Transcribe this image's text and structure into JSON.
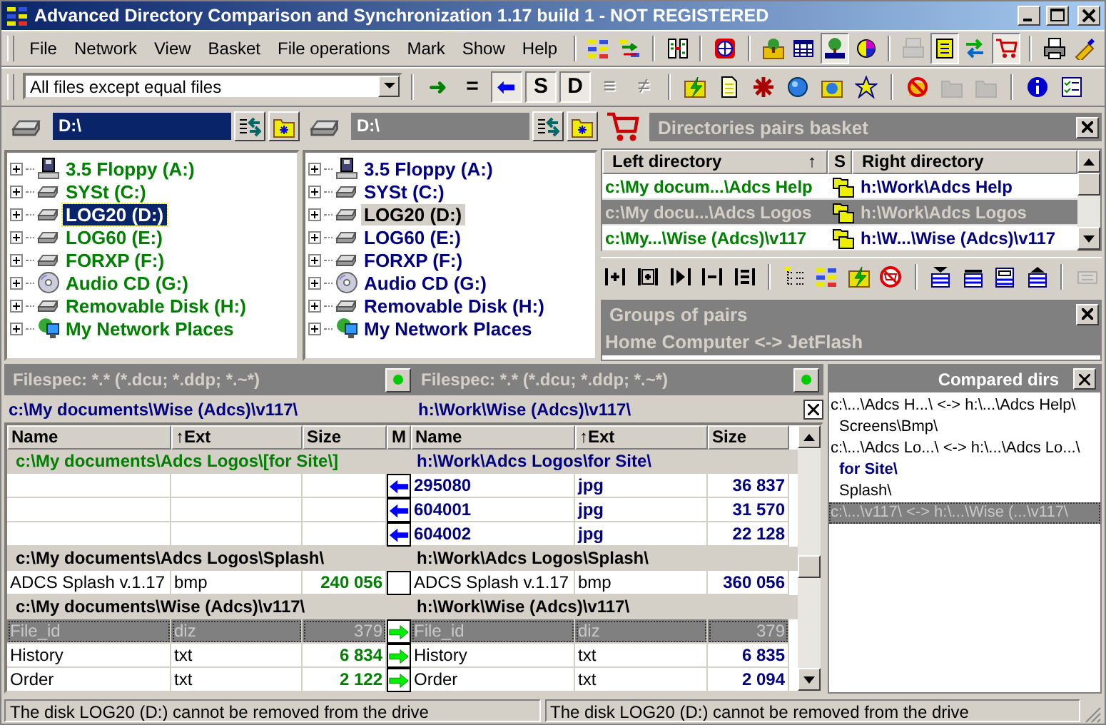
{
  "window": {
    "title": "Advanced Directory Comparison and Synchronization 1.17 build 1 - NOT REGISTERED"
  },
  "menu": [
    "File",
    "Network",
    "View",
    "Basket",
    "File operations",
    "Mark",
    "Show",
    "Help"
  ],
  "toolbar": [
    {
      "kind": "compare",
      "pressed": false,
      "disabled": false
    },
    {
      "kind": "sync",
      "pressed": false,
      "disabled": false
    },
    {
      "kind": "sep"
    },
    {
      "kind": "columns",
      "pressed": false,
      "disabled": false
    },
    {
      "kind": "sep"
    },
    {
      "kind": "globe",
      "pressed": false,
      "disabled": false
    },
    {
      "kind": "sep"
    },
    {
      "kind": "tree-folder",
      "pressed": false,
      "disabled": false
    },
    {
      "kind": "grid",
      "pressed": false,
      "disabled": false
    },
    {
      "kind": "tree",
      "pressed": true,
      "disabled": false
    },
    {
      "kind": "pie",
      "pressed": false,
      "disabled": false
    },
    {
      "kind": "sep"
    },
    {
      "kind": "save",
      "pressed": false,
      "disabled": true
    },
    {
      "kind": "notes",
      "pressed": true,
      "disabled": false
    },
    {
      "kind": "swap",
      "pressed": false,
      "disabled": false
    },
    {
      "kind": "cart",
      "pressed": true,
      "disabled": false
    },
    {
      "kind": "sep"
    },
    {
      "kind": "printer",
      "pressed": false,
      "disabled": false
    },
    {
      "kind": "brush",
      "pressed": false,
      "disabled": false
    }
  ],
  "filter": {
    "value": "All files except equal files"
  },
  "mode_buttons": [
    {
      "label": "➜",
      "color": "#008000",
      "pressed": false,
      "disabled": false
    },
    {
      "label": "=",
      "color": "#000000",
      "pressed": false,
      "disabled": false
    },
    {
      "label": "⬅",
      "color": "#0000ff",
      "pressed": true,
      "disabled": false
    },
    {
      "label": "S",
      "color": "#000000",
      "pressed": true,
      "disabled": false
    },
    {
      "label": "D",
      "color": "#000000",
      "pressed": true,
      "disabled": false
    },
    {
      "label": "≡",
      "color": "#808080",
      "pressed": false,
      "disabled": true
    },
    {
      "label": "≠",
      "color": "#808080",
      "pressed": false,
      "disabled": true
    }
  ],
  "toolbar2": [
    {
      "kind": "lightning-folder",
      "disabled": false
    },
    {
      "kind": "document",
      "disabled": false
    },
    {
      "kind": "asterisk",
      "disabled": false
    },
    {
      "kind": "ball",
      "disabled": false
    },
    {
      "kind": "folder-globe",
      "disabled": false
    },
    {
      "kind": "star",
      "disabled": false
    },
    {
      "kind": "sep"
    },
    {
      "kind": "no-folder",
      "disabled": false
    },
    {
      "kind": "folder-grey",
      "disabled": true
    },
    {
      "kind": "folder-grey",
      "disabled": true
    },
    {
      "kind": "sep"
    },
    {
      "kind": "info",
      "disabled": false
    },
    {
      "kind": "checklist",
      "disabled": false
    }
  ],
  "drive_panels": [
    {
      "path": "D:\\",
      "focused": true,
      "items": [
        {
          "name": "3.5 Floppy (A:)",
          "kind": "floppy",
          "expanded": false,
          "selected": false
        },
        {
          "name": "SYSt (C:)",
          "kind": "drive",
          "expanded": false,
          "selected": false
        },
        {
          "name": "LOG20 (D:)",
          "kind": "drive",
          "expanded": false,
          "selected": true
        },
        {
          "name": "LOG60 (E:)",
          "kind": "drive",
          "expanded": false,
          "selected": false
        },
        {
          "name": "FORXP (F:)",
          "kind": "drive",
          "expanded": false,
          "selected": false
        },
        {
          "name": "Audio CD (G:)",
          "kind": "cd",
          "expanded": false,
          "selected": false
        },
        {
          "name": "Removable Disk (H:)",
          "kind": "drive",
          "expanded": false,
          "selected": false
        },
        {
          "name": "My Network Places",
          "kind": "network",
          "expanded": false,
          "selected": false
        }
      ]
    },
    {
      "path": "D:\\",
      "focused": false,
      "items": [
        {
          "name": "3.5 Floppy (A:)",
          "kind": "floppy",
          "expanded": false,
          "selected": false
        },
        {
          "name": "SYSt (C:)",
          "kind": "drive",
          "expanded": false,
          "selected": false
        },
        {
          "name": "LOG20 (D:)",
          "kind": "drive",
          "expanded": false,
          "selected": true
        },
        {
          "name": "LOG60 (E:)",
          "kind": "drive",
          "expanded": false,
          "selected": false
        },
        {
          "name": "FORXP (F:)",
          "kind": "drive",
          "expanded": false,
          "selected": false
        },
        {
          "name": "Audio CD (G:)",
          "kind": "cd",
          "expanded": false,
          "selected": false
        },
        {
          "name": "Removable Disk (H:)",
          "kind": "drive",
          "expanded": false,
          "selected": false
        },
        {
          "name": "My Network Places",
          "kind": "network",
          "expanded": false,
          "selected": false
        }
      ]
    }
  ],
  "basket": {
    "title": "Directories pairs basket",
    "columns": [
      "Left directory",
      "S",
      "Right directory"
    ],
    "sort_mark": "↑",
    "rows": [
      {
        "left": "c:\\My docum...\\Adcs Help",
        "right": "h:\\Work\\Adcs Help",
        "selected": false
      },
      {
        "left": "c:\\My docu...\\Adcs Logos",
        "right": "h:\\Work\\Adcs Logos",
        "selected": true
      },
      {
        "left": "c:\\My...\\Wise (Adcs)\\v117",
        "right": "h:\\W...\\Wise (Adcs)\\v117",
        "selected": false
      }
    ],
    "toolbar": [
      {
        "kind": "bar-plus",
        "disabled": false
      },
      {
        "kind": "bracket-plus",
        "disabled": false
      },
      {
        "kind": "play-bracket",
        "disabled": false
      },
      {
        "kind": "bar-minus",
        "disabled": false
      },
      {
        "kind": "bar-list",
        "disabled": false
      },
      {
        "kind": "sep"
      },
      {
        "kind": "tree-list",
        "disabled": false
      },
      {
        "kind": "compare",
        "disabled": false
      },
      {
        "kind": "lightning-folder",
        "disabled": false
      },
      {
        "kind": "cart-no",
        "disabled": false
      },
      {
        "kind": "sep"
      },
      {
        "kind": "move-top",
        "disabled": false
      },
      {
        "kind": "move-down",
        "disabled": false
      },
      {
        "kind": "move-up",
        "disabled": false
      },
      {
        "kind": "move-bottom",
        "disabled": false
      },
      {
        "kind": "sep"
      },
      {
        "kind": "panel",
        "disabled": true
      }
    ]
  },
  "groups": {
    "title": "Groups of pairs",
    "items": [
      {
        "text": "Home Computer <-> JetFlash",
        "selected": true
      }
    ]
  },
  "compare": {
    "filespecs": [
      "Filespec: *.* (*.dcu; *.ddp; *.~*)",
      "Filespec: *.* (*.dcu; *.ddp; *.~*)"
    ],
    "paths": [
      "c:\\My documents\\Wise (Adcs)\\v117\\",
      "h:\\Work\\Wise (Adcs)\\v117\\"
    ],
    "columns": [
      "Name",
      "↑Ext",
      "Size",
      "M",
      "Name",
      "↑Ext",
      "Size"
    ],
    "rows": [
      {
        "kind": "folder",
        "left": "c:\\My documents\\Adcs Logos\\[for Site\\]",
        "right": "h:\\Work\\Adcs Logos\\for Site\\",
        "differs": true
      },
      {
        "kind": "file",
        "right": {
          "name": "295080",
          "ext": "jpg",
          "size": "36 837"
        },
        "copy_to_left": true,
        "copy_to_right": false,
        "selected": false
      },
      {
        "kind": "file",
        "right": {
          "name": "604001",
          "ext": "jpg",
          "size": "31 570"
        },
        "copy_to_left": true,
        "copy_to_right": false,
        "selected": false
      },
      {
        "kind": "file",
        "right": {
          "name": "604002",
          "ext": "jpg",
          "size": "22 128"
        },
        "copy_to_left": true,
        "copy_to_right": false,
        "selected": false
      },
      {
        "kind": "folder",
        "left": "c:\\My documents\\Adcs Logos\\Splash\\",
        "right": "h:\\Work\\Adcs Logos\\Splash\\",
        "differs": false
      },
      {
        "kind": "file",
        "left": {
          "name": "ADCS Splash v.1.17",
          "ext": "bmp",
          "size": "240 056"
        },
        "right": {
          "name": "ADCS Splash v.1.17",
          "ext": "bmp",
          "size": "360 056"
        },
        "copy_to_left": false,
        "copy_to_right": false,
        "selected": false
      },
      {
        "kind": "folder",
        "left": "c:\\My documents\\Wise (Adcs)\\v117\\",
        "right": "h:\\Work\\Wise (Adcs)\\v117\\",
        "differs": false
      },
      {
        "kind": "file",
        "left": {
          "name": "File_id",
          "ext": "diz",
          "size": "379"
        },
        "right": {
          "name": "File_id",
          "ext": "diz",
          "size": "379"
        },
        "copy_to_left": false,
        "copy_to_right": true,
        "selected": true
      },
      {
        "kind": "file",
        "left": {
          "name": "History",
          "ext": "txt",
          "size": "6 834"
        },
        "right": {
          "name": "History",
          "ext": "txt",
          "size": "6 835"
        },
        "copy_to_left": false,
        "copy_to_right": true,
        "selected": false
      },
      {
        "kind": "file",
        "left": {
          "name": "Order",
          "ext": "txt",
          "size": "2 122"
        },
        "right": {
          "name": "Order",
          "ext": "txt",
          "size": "2 094"
        },
        "copy_to_left": false,
        "copy_to_right": true,
        "selected": false
      }
    ]
  },
  "compared_dirs": {
    "title": "Compared dirs",
    "items": [
      {
        "text": "c:\\...\\Adcs H...\\ <-> h:\\...\\Adcs Help\\",
        "current": false,
        "selected": false,
        "children": [
          {
            "text": "Screens\\Bmp\\",
            "current": false,
            "selected": false
          }
        ]
      },
      {
        "text": "c:\\...\\Adcs Lo...\\ <-> h:\\...\\Adcs Lo...\\",
        "current": false,
        "selected": false,
        "children": [
          {
            "text": "for Site\\",
            "current": true,
            "selected": false
          },
          {
            "text": "Splash\\",
            "current": false,
            "selected": false
          }
        ]
      },
      {
        "text": "c:\\...\\v117\\ <-> h:\\...\\Wise (...\\v117\\",
        "current": false,
        "selected": true
      }
    ]
  },
  "status_bar": [
    "The disk LOG20 (D:) cannot be removed from the drive",
    "The disk LOG20 (D:) cannot be removed from the drive"
  ]
}
